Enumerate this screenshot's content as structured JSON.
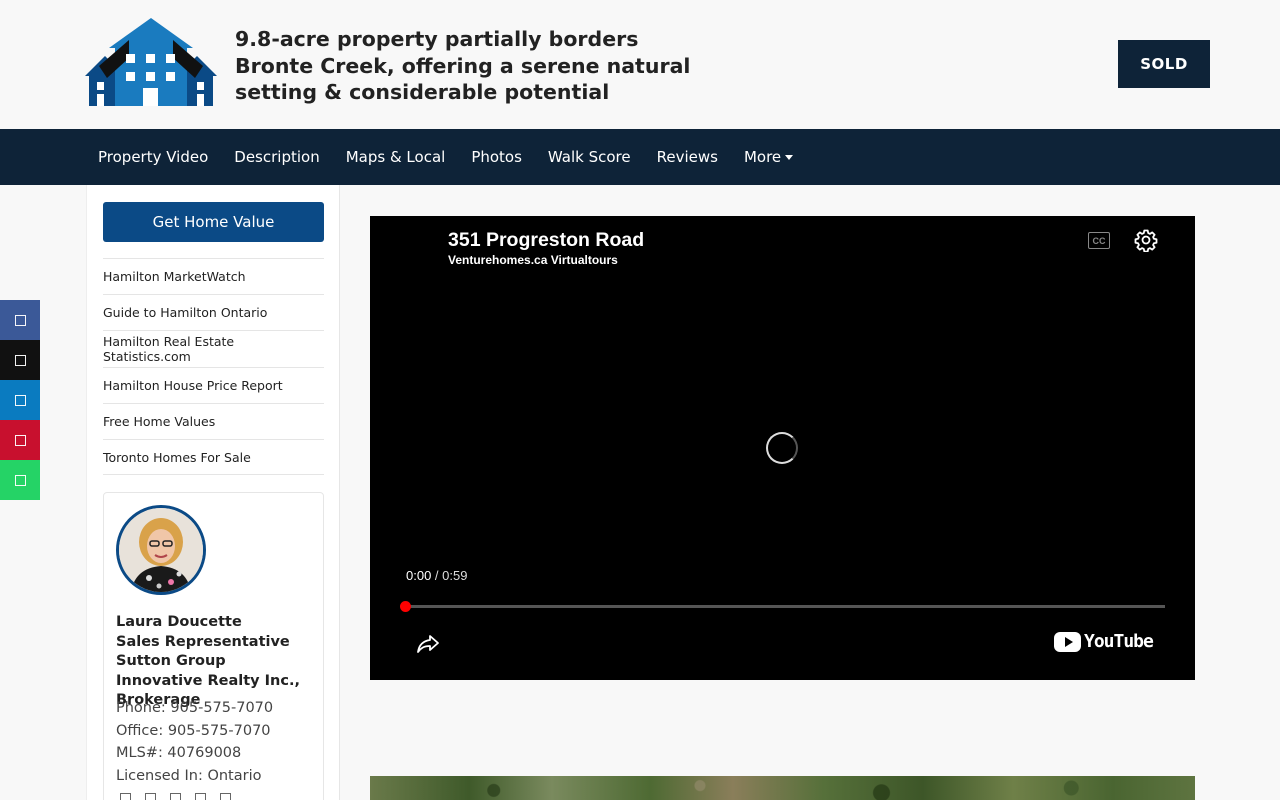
{
  "header": {
    "headline": "9.8-acre property partially borders Bronte Creek, offering a serene natural setting & considerable potential",
    "status_badge": "SOLD",
    "logo_icon": "houses-logo-icon"
  },
  "nav": {
    "items": [
      {
        "label": "Property Video"
      },
      {
        "label": "Description"
      },
      {
        "label": "Maps & Local"
      },
      {
        "label": "Photos"
      },
      {
        "label": "Walk Score"
      },
      {
        "label": "Reviews"
      },
      {
        "label": "More"
      }
    ]
  },
  "social": {
    "buttons": [
      {
        "name": "facebook-icon",
        "color": "#3b5998"
      },
      {
        "name": "x-icon",
        "color": "#111111"
      },
      {
        "name": "linkedin-icon",
        "color": "#0a7bc0"
      },
      {
        "name": "pinterest-icon",
        "color": "#c8102e"
      },
      {
        "name": "whatsapp-icon",
        "color": "#25d366"
      }
    ]
  },
  "sidebar": {
    "cta_label": "Get Home Value",
    "links": [
      {
        "label": "Hamilton MarketWatch"
      },
      {
        "label": "Guide to Hamilton Ontario"
      },
      {
        "label": "Hamilton Real Estate Statistics.com"
      },
      {
        "label": "Hamilton House Price Report"
      },
      {
        "label": "Free Home Values"
      },
      {
        "label": "Toronto Homes For Sale"
      }
    ],
    "agent": {
      "name": "Laura Doucette",
      "title": "Sales Representative",
      "brokerage": "Sutton Group Innovative Realty Inc., Brokerage",
      "phone": "Phone: 905-575-7070",
      "office": "Office: 905-575-7070",
      "mls": "MLS#: 40769008",
      "licensed": "Licensed In: Ontario"
    }
  },
  "video": {
    "title": "351 Progreston Road",
    "channel": "Venturehomes.ca Virtualtours",
    "time_current": "0:00",
    "time_separator": " / ",
    "time_duration": "0:59",
    "cc_label": "CC",
    "progress": 0,
    "brand": "YouTube"
  },
  "colors": {
    "navy": "#0e2338",
    "accent_blue": "#0b4a86"
  }
}
